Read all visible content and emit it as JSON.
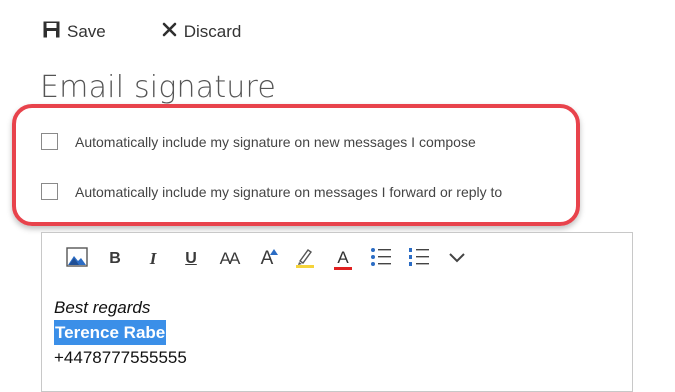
{
  "toolbar": {
    "save_label": "Save",
    "discard_label": "Discard"
  },
  "page": {
    "title": "Email signature"
  },
  "options": [
    {
      "label": "Automatically include my signature on new messages I compose",
      "checked": false
    },
    {
      "label": "Automatically include my signature on messages I forward or reply to",
      "checked": false
    }
  ],
  "editor": {
    "toolbar_icons": [
      "insert-picture-icon",
      "bold-icon",
      "italic-icon",
      "underline-icon",
      "font-size-icon",
      "grow-font-icon",
      "highlight-icon",
      "font-color-icon",
      "bullets-icon",
      "numbering-icon",
      "more-options-icon"
    ],
    "glyphs": {
      "bold": "B",
      "italic": "I",
      "underline": "U",
      "font_size": "AA",
      "grow": "A",
      "font_color": "A"
    },
    "lines": [
      "Best regards",
      "Terence Rabe",
      "+4478777555555"
    ]
  },
  "colors": {
    "highlight_border": "#e8434c",
    "selection": "#3b8fe8",
    "font_color_bar": "#e02020",
    "highlight_bar": "#f5d33a",
    "picture_icon": "#2b6cc4"
  }
}
